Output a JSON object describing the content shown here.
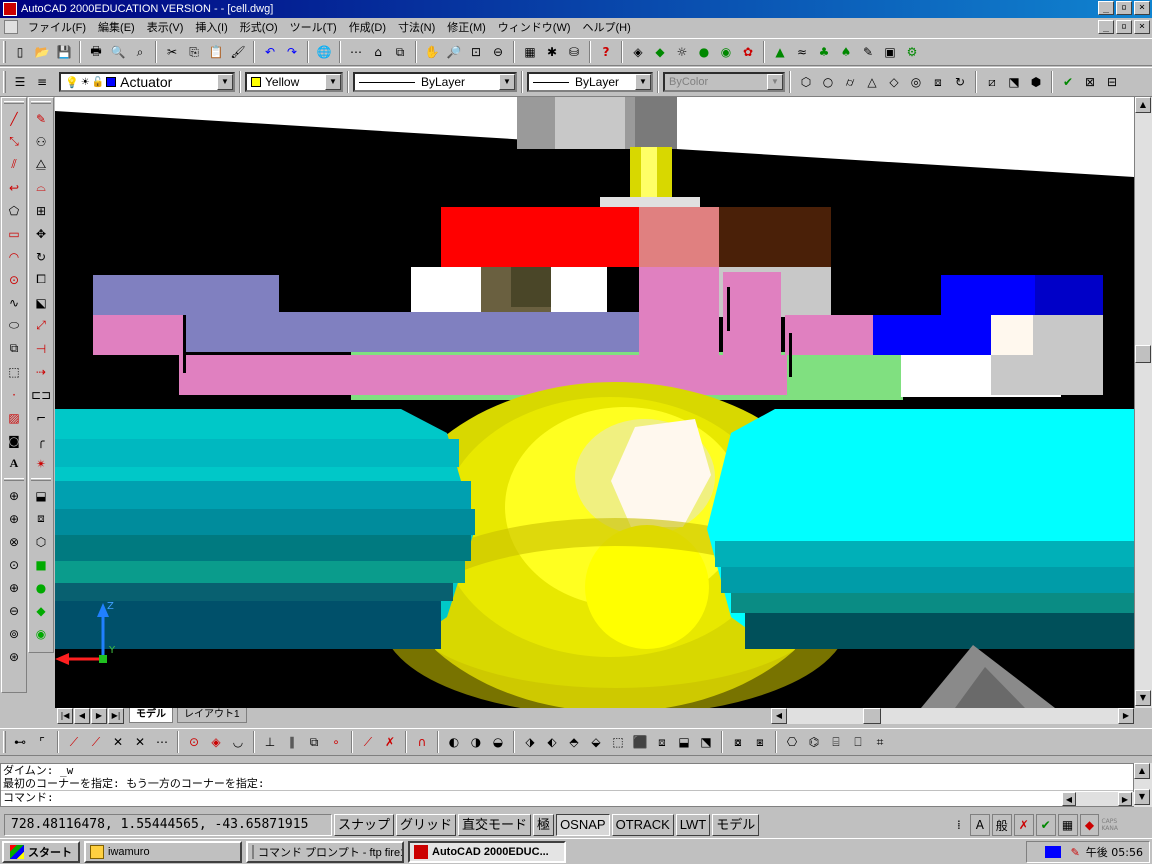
{
  "window": {
    "title": "AutoCAD 2000EDUCATION VERSION - - [cell.dwg]",
    "controls": [
      "_",
      "▫",
      "×"
    ]
  },
  "menu": {
    "items": [
      "ファイル(F)",
      "編集(E)",
      "表示(V)",
      "挿入(I)",
      "形式(O)",
      "ツール(T)",
      "作成(D)",
      "寸法(N)",
      "修正(M)",
      "ウィンドウ(W)",
      "ヘルプ(H)"
    ],
    "doc_controls": [
      "_",
      "▫",
      "×"
    ]
  },
  "layer_toolbar": {
    "layer": "Actuator",
    "color": "Yellow",
    "color_hex": "#ffff00",
    "linetype": "ByLayer",
    "lineweight": "ByLayer",
    "plotstyle": "ByColor"
  },
  "tabs": [
    "モデル",
    "レイアウト1"
  ],
  "command": {
    "lines": [
      "ダイムン: _w",
      "最初のコーナーを指定: もう一方のコーナーを指定:",
      "コマンド:"
    ]
  },
  "status": {
    "coords": "728.48116478, 1.55444565, -43.65871915",
    "buttons": [
      {
        "label": "スナップ",
        "on": false
      },
      {
        "label": "グリッド",
        "on": false
      },
      {
        "label": "直交モード",
        "on": false
      },
      {
        "label": "極",
        "on": false
      },
      {
        "label": "OSNAP",
        "on": true
      },
      {
        "label": "OTRACK",
        "on": false
      },
      {
        "label": "LWT",
        "on": false
      },
      {
        "label": "モデル",
        "on": false
      }
    ]
  },
  "taskbar": {
    "start": "スタート",
    "tasks": [
      {
        "label": "iwamuro",
        "active": false
      },
      {
        "label": "コマンド プロンプト - ftp fire1",
        "active": false
      },
      {
        "label": "AutoCAD 2000EDUC...",
        "active": true
      }
    ],
    "clock": "午後 05:56"
  },
  "ucs": {
    "z_label": "Z",
    "y_label": "Y",
    "x_label": "X"
  },
  "colors": {
    "viewport_bg": "#000000",
    "title_start": "#000080",
    "title_end": "#1084d0"
  }
}
